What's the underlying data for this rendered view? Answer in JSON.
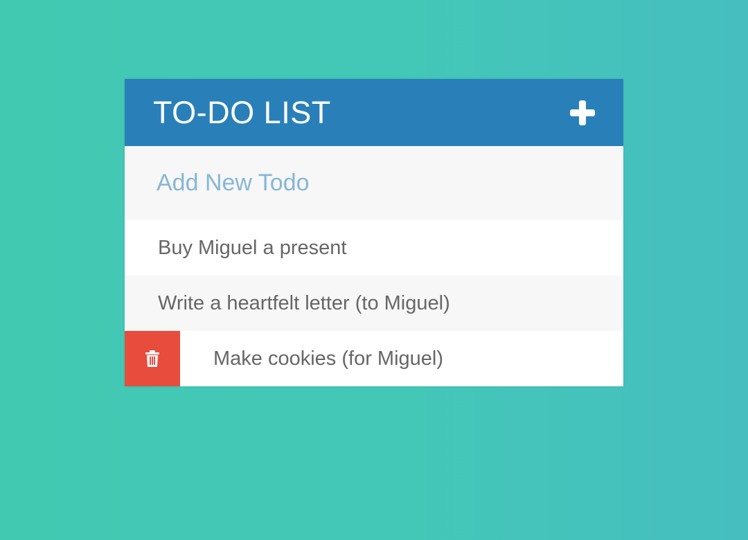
{
  "header": {
    "title": "TO-DO LIST"
  },
  "new_todo": {
    "placeholder": "Add New Todo",
    "value": ""
  },
  "todos": [
    {
      "text": "Buy Miguel a present"
    },
    {
      "text": "Write a heartfelt letter (to Miguel)"
    },
    {
      "text": "Make cookies (for Miguel)"
    }
  ],
  "colors": {
    "header": "#2980b9",
    "delete": "#e74c3c",
    "text": "#666666",
    "placeholder": "#86b6d6"
  },
  "icons": {
    "add": "plus-icon",
    "delete": "trash-icon"
  }
}
